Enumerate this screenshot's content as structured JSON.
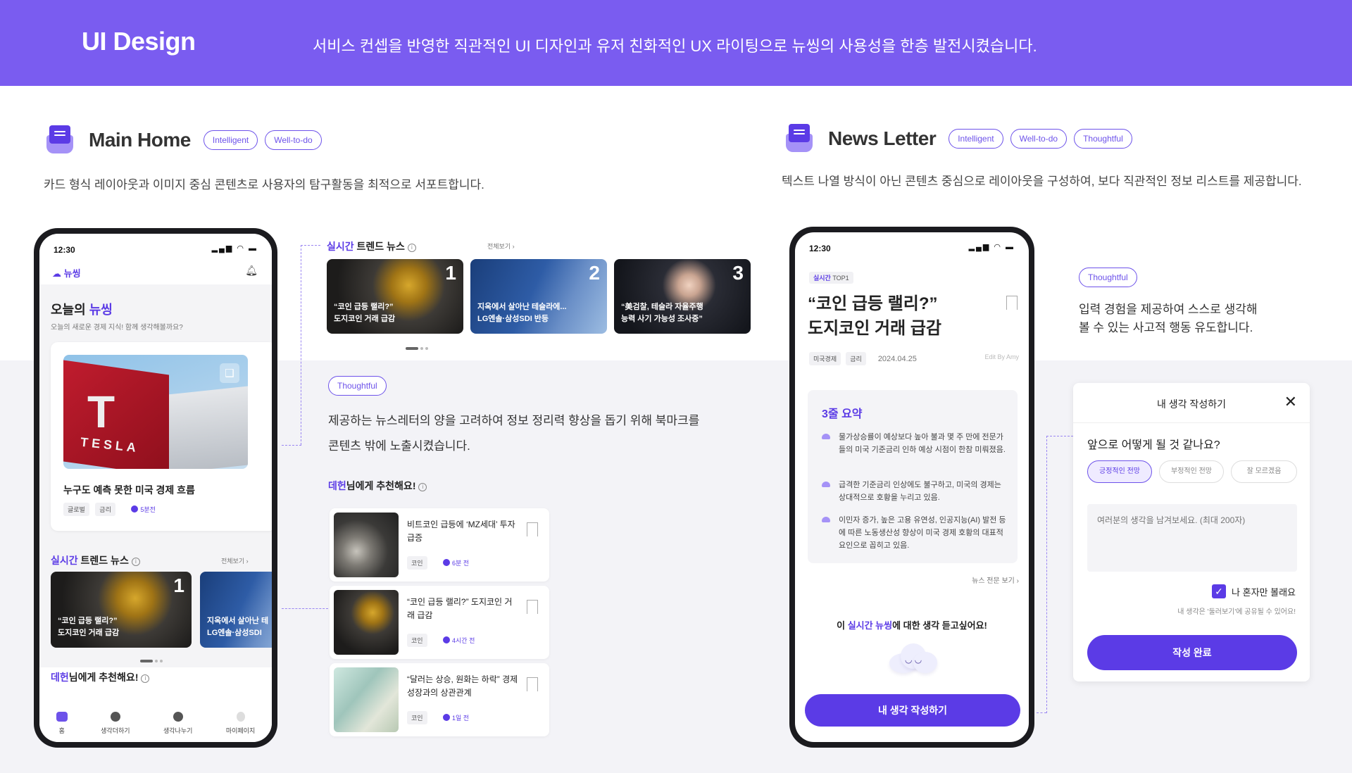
{
  "header": {
    "title": "UI Design",
    "subtitle": "서비스 컨셉을 반영한 직관적인 UI 디자인과 유저 친화적인 UX 라이팅으로  뉴씽의 사용성을 한층 발전시켰습니다."
  },
  "colors": {
    "accent": "#5b3be6",
    "banner": "#7a5cf0",
    "band": "#f3f3f7"
  },
  "main_home": {
    "title": "Main Home",
    "pills": [
      "Intelligent",
      "Well-to-do"
    ],
    "description": "카드 형식 레이아웃과 이미지 중심 콘텐츠로 사용자의 탐구활동을 최적으로 서포트합니다."
  },
  "news_letter": {
    "title": "News Letter",
    "pills": [
      "Intelligent",
      "Well-to-do",
      "Thoughtful"
    ],
    "description": "텍스트 나열 방식이 아닌 콘텐츠 중심으로 레이아웃을 구성하여, 보다 직관적인 정보 리스트를 제공합니다."
  },
  "home_phone": {
    "time": "12:30",
    "logo": "뉴씽",
    "greeting_prefix": "오늘의",
    "greeting_accent": "뉴씽",
    "greeting_sub": "오늘의 새로운 경제 지식! 함께 생각해볼까요?",
    "main_card": {
      "title": "누구도 예측 못한 미국 경제 흐름",
      "tags": [
        "글로벌",
        "금리"
      ],
      "time": "5분전"
    },
    "trend": {
      "accent": "실시간",
      "label": "트렌드 뉴스",
      "see_all": "전체보기"
    },
    "trend_cards": [
      {
        "rank": "1",
        "line1": "“코인 급등 랠리?”",
        "line2": "도지코인 거래 급감"
      },
      {
        "rank": "2",
        "line1": "지옥에서 살아난 테",
        "line2": "LG엔솔·삼성SDI"
      }
    ],
    "rec": {
      "accent": "데헌",
      "label": "님에게 추천해요!"
    },
    "tabs": [
      "홈",
      "생각더하기",
      "생각나누기",
      "마이페이지"
    ]
  },
  "middle": {
    "trend": {
      "accent": "실시간",
      "label": "트렌드 뉴스",
      "see_all": "전체보기"
    },
    "trend_cards": [
      {
        "rank": "1",
        "line1": "“코인 급등 랠리?”",
        "line2": "도지코인 거래 급감"
      },
      {
        "rank": "2",
        "line1": "지옥에서 살아난 테슬라에...",
        "line2": "LG엔솔·삼성SDI 반등"
      },
      {
        "rank": "3",
        "line1": "“美검찰, 테슬라 자율주행",
        "line2": "능력 사기 가능성 조사중”"
      }
    ],
    "pill": "Thoughtful",
    "text_line1": "제공하는 뉴스레터의 양을 고려하여 정보 정리력 향상을 돕기 위해 북마크를",
    "text_line2": "콘텐츠 밖에 노출시켰습니다.",
    "rec": {
      "accent": "데헌",
      "label": "님에게 추천해요!"
    },
    "rec_cards": [
      {
        "title": "비트코인 급등에 ‘MZ세대’ 투자 급증",
        "tag": "코인",
        "time": "6분 전"
      },
      {
        "title": "“코인 급등 랠리?” 도지코인 거래 급감",
        "tag": "코인",
        "time": "4시간 전"
      },
      {
        "title": "“달러는 상승, 원화는 하락” 경제성장과의 상관관계",
        "tag": "코인",
        "time": "1일 전"
      }
    ]
  },
  "nl_phone": {
    "time": "12:30",
    "kicker_accent": "실시간",
    "kicker_rest": " TOP1",
    "title_line1": "“코인 급등 랠리?”",
    "title_line2": "도지코인 거래 급감",
    "tags": [
      "미국경제",
      "금리"
    ],
    "date": "2024.04.25",
    "edit": "Edit By Amy",
    "summary_title": "3줄 요약",
    "summary": [
      "물가상승률이 예상보다 높아 불과 몇 주 만에 전문가들의 미국 기준금리 인하 예상 시점이 한참 미뤄졌음.",
      "급격한 기준금리 인상에도 불구하고, 미국의 경제는 상대적으로 호황을 누리고 있음.",
      "이민자 증가, 높은 고용 유연성, 인공지능(AI) 발전 등에 따른 노동생산성 향상이 미국 경제 호황의 대표적 요인으로 꼽히고 있음."
    ],
    "full_link": "뉴스 전문 보기",
    "ask_prefix": "이 ",
    "ask_accent": "실시간 뉴씽",
    "ask_rest": "에 대한 생각 듣고싶어요!",
    "cta": "내 생각 작성하기"
  },
  "right": {
    "pill": "Thoughtful",
    "text_line1": "입력 경험을 제공하여 스스로 생각해",
    "text_line2": "볼 수 있는 사고적 행동 유도합니다."
  },
  "modal": {
    "title": "내 생각 작성하기",
    "question": "앞으로 어떻게 될 것 같나요?",
    "options": [
      "긍정적인 전망",
      "부정적인 전망",
      "잘 모르겠음"
    ],
    "placeholder": "여러분의 생각을 남겨보세요. (최대 200자)",
    "checkbox_label": "나 혼자만 볼래요",
    "checkbox_note": "내 생각은 '둘러보기'에 공유될 수 있어요!",
    "submit": "작성 완료"
  }
}
